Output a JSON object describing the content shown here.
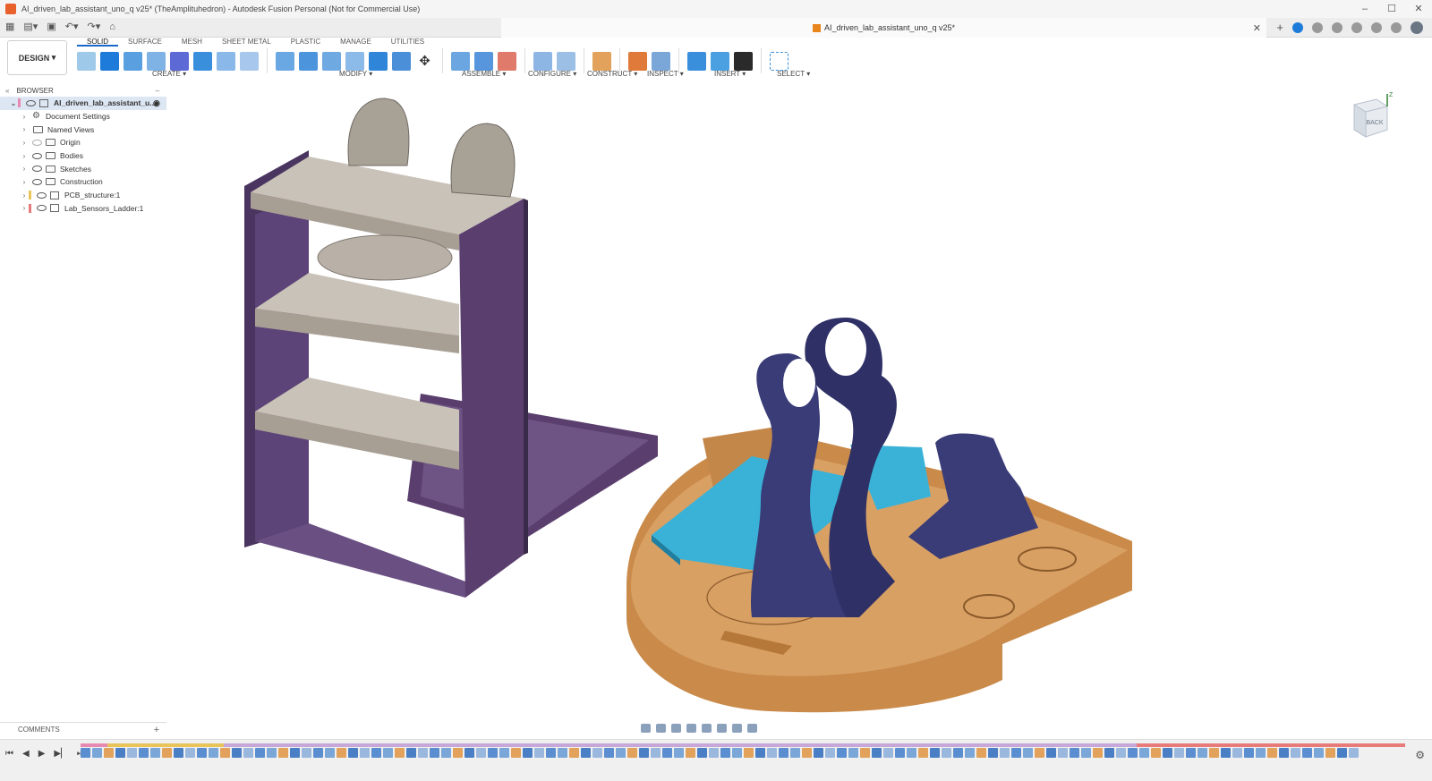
{
  "window": {
    "title": "AI_driven_lab_assistant_uno_q v25* (TheAmplituhedron) - Autodesk Fusion Personal (Not for Commercial Use)"
  },
  "document_tab": {
    "label": "AI_driven_lab_assistant_uno_q v25*"
  },
  "toolbar": {
    "workspace_button": "DESIGN",
    "tabs": [
      "SOLID",
      "SURFACE",
      "MESH",
      "SHEET METAL",
      "PLASTIC",
      "MANAGE",
      "UTILITIES"
    ],
    "active_tab": "SOLID",
    "groups": [
      "CREATE",
      "MODIFY",
      "ASSEMBLE",
      "CONFIGURE",
      "CONSTRUCT",
      "INSPECT",
      "INSERT",
      "SELECT"
    ]
  },
  "browser": {
    "header": "BROWSER",
    "root": "AI_driven_lab_assistant_u...",
    "items": [
      {
        "label": "Document Settings",
        "icon": "gear-icon"
      },
      {
        "label": "Named Views",
        "icon": "folder-icon"
      },
      {
        "label": "Origin",
        "icon": "folder-icon"
      },
      {
        "label": "Bodies",
        "icon": "folder-icon"
      },
      {
        "label": "Sketches",
        "icon": "folder-icon"
      },
      {
        "label": "Construction",
        "icon": "folder-icon"
      },
      {
        "label": "PCB_structure:1",
        "icon": "component-icon"
      },
      {
        "label": "Lab_Sensors_Ladder:1",
        "icon": "component-icon"
      }
    ]
  },
  "comments": {
    "label": "COMMENTS"
  },
  "viewcube": {
    "face_label": "BACK",
    "axis_label": "Z"
  },
  "colors": {
    "accent": "#1b6ac9",
    "ladder_purple": "#5a3f6e",
    "shelf_grey": "#c9c2b8",
    "base_brown": "#c98a4a",
    "pcb_blue": "#3ab2d8",
    "stand_navy": "#3a3c78"
  }
}
